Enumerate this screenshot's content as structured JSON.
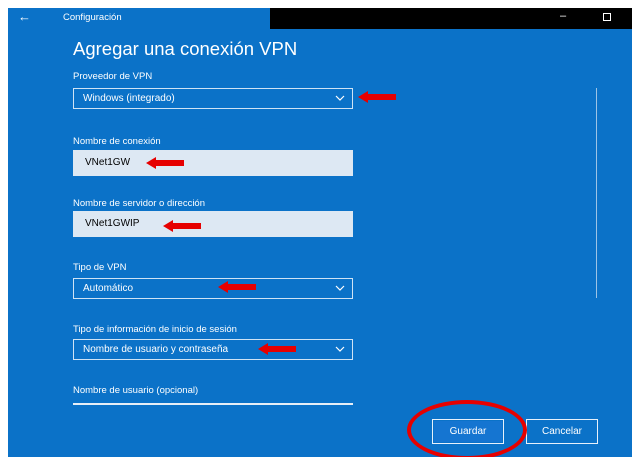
{
  "window": {
    "title": "Configuración"
  },
  "heading": "Agregar una conexión VPN",
  "fields": {
    "vpn_provider": {
      "label": "Proveedor de VPN",
      "value": "Windows (integrado)"
    },
    "connection_name": {
      "label": "Nombre de conexión",
      "value": "VNet1GW"
    },
    "server": {
      "label": "Nombre de servidor o dirección",
      "value": "VNet1GWIP"
    },
    "vpn_type": {
      "label": "Tipo de VPN",
      "value": "Automático"
    },
    "signin_type": {
      "label": "Tipo de información de inicio de sesión",
      "value": "Nombre de usuario y contraseña"
    },
    "username": {
      "label": "Nombre de usuario (opcional)"
    }
  },
  "buttons": {
    "save": "Guardar",
    "cancel": "Cancelar"
  },
  "annotation": {
    "color": "#e60000",
    "icon": "arrow-left-icon"
  },
  "accent": "#0b72c8"
}
